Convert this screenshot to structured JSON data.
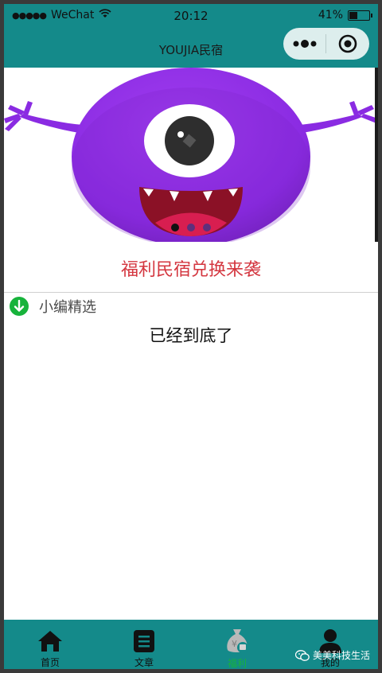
{
  "status_bar": {
    "signal": "●●●●●",
    "carrier": "WeChat",
    "time": "20:12",
    "battery_percent": "41%",
    "battery_level": 0.41
  },
  "nav": {
    "title": "YOUJIA民宿",
    "more_icon": "more-dots-icon",
    "close_icon": "target-close-icon"
  },
  "banner": {
    "image": "purple-one-eyed-monster",
    "slides": 3,
    "active_slide": 0
  },
  "promo_text": "福利民宿兑换来袭",
  "section": {
    "icon": "down-arrow-circle-icon",
    "title": "小编精选"
  },
  "end_text": "已经到底了",
  "tabbar": {
    "tabs": [
      {
        "label": "首页",
        "icon": "home-icon"
      },
      {
        "label": "文章",
        "icon": "article-icon"
      },
      {
        "label": "福利",
        "icon": "money-bag-icon"
      },
      {
        "label": "我的",
        "icon": "user-icon"
      }
    ],
    "active_index": 2
  },
  "watermark": "美美科技生活",
  "colors": {
    "header": "#148a8a",
    "promo": "#d4363f",
    "accent_green": "#17b33b",
    "monster": "#8a2be2"
  }
}
